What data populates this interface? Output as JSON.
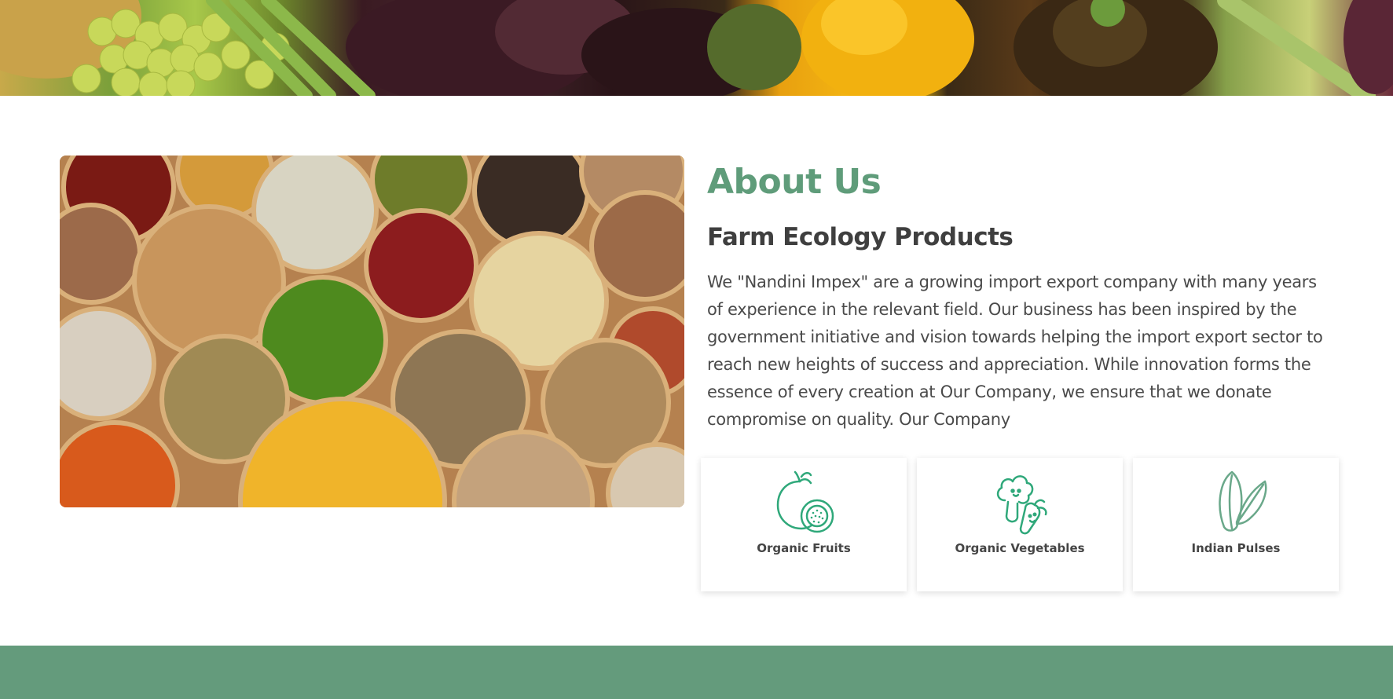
{
  "about": {
    "title": "About Us",
    "subtitle": "Farm Ecology Products",
    "paragraph": "We \"Nandini Impex\" are a growing import export company with many years of experience in the relevant field. Our business has been inspired by the government initiative and vision towards helping the import export sector to reach new heights of success and appreciation. While innovation forms the essence of every creation at Our Company, we ensure that we donate compromise on quality. Our Company"
  },
  "features": [
    {
      "label": "Organic Fruits",
      "icon": "fruits-icon"
    },
    {
      "label": "Organic Vegetables",
      "icon": "vegetables-icon"
    },
    {
      "label": "Indian Pulses",
      "icon": "pulses-icon"
    }
  ],
  "colors": {
    "accent": "#5f9c7a",
    "icon_green": "#2fa87a",
    "footer": "#649b7c",
    "heading": "#3f3f3f",
    "body_text": "#4a4a4a"
  }
}
